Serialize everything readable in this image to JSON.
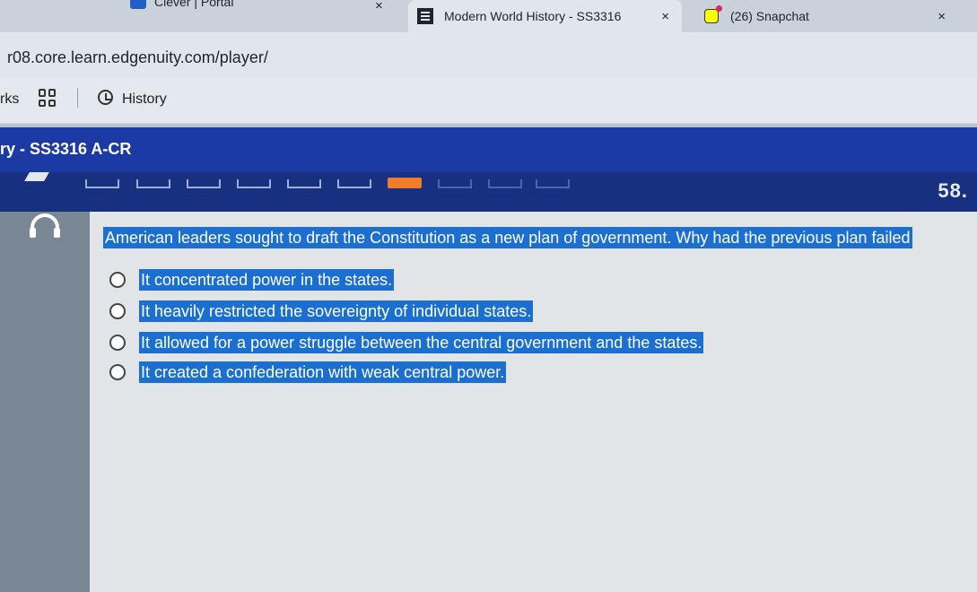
{
  "browser": {
    "tabs": [
      {
        "title": "Clever | Portal",
        "close": "×"
      },
      {
        "title": "Modern World History - SS3316",
        "close": "×"
      },
      {
        "title": "(26) Snapchat",
        "close": "×"
      }
    ],
    "url": "r08.core.learn.edgenuity.com/player/",
    "bookmarks": {
      "first": "rks",
      "history": "History"
    }
  },
  "course": {
    "title": "ry - SS3316 A-CR"
  },
  "progress": {
    "counter": "58."
  },
  "question": {
    "prompt": "American leaders sought to draft the Constitution as a new plan of government. Why had the previous plan failed",
    "choices": [
      "It concentrated power in the states.",
      "It heavily restricted the sovereignty of individual states.",
      "It allowed for a power struggle between the central government and the states.",
      "It created a confederation with weak central power."
    ]
  }
}
